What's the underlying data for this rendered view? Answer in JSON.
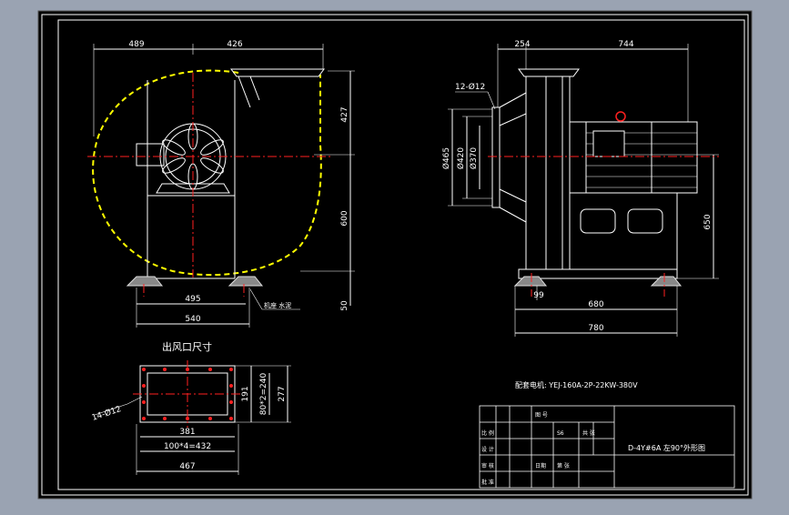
{
  "colors": {
    "background": "#9aa3b2",
    "sheet": "#000000",
    "line": "#ffffff",
    "centerline": "#ff2020",
    "volute": "#ffff00"
  },
  "left_view": {
    "dim_top_left": "489",
    "dim_top_right": "426",
    "dim_right_upper": "427",
    "dim_right_lower": "600",
    "dim_right_base": "50",
    "dim_bottom_1": "495",
    "dim_bottom_2": "540",
    "callout_label": "机座 水泥"
  },
  "right_view": {
    "dim_top_left": "254",
    "dim_top_right": "744",
    "hole_callout": "12-Ø12",
    "dim_flange_1": "Ø465",
    "dim_flange_2": "Ø420",
    "dim_flange_3": "Ø370",
    "dim_height": "650",
    "dim_offset": "99",
    "dim_base_inner": "680",
    "dim_base_outer": "780",
    "motor_spec": "配套电机: YEJ-160A-2P-22KW-380V"
  },
  "outlet": {
    "title": "出风口尺寸",
    "hole_callout": "14-Ø12",
    "dim_v1": "191",
    "dim_v2": "80*2=240",
    "dim_v3": "277",
    "dim_h1": "381",
    "dim_h2": "100*4=432",
    "dim_h3": "467"
  },
  "title_block": {
    "drawing_title": "D-4Y#6A 左90°外形图",
    "cell_a": "比 例",
    "cell_b": "图 号",
    "cell_c": "设 计",
    "cell_d": "审 核",
    "cell_e": "批 准",
    "cell_f": "日期",
    "cell_g": "S6",
    "cell_h": "共 张",
    "cell_i": "第 张"
  }
}
